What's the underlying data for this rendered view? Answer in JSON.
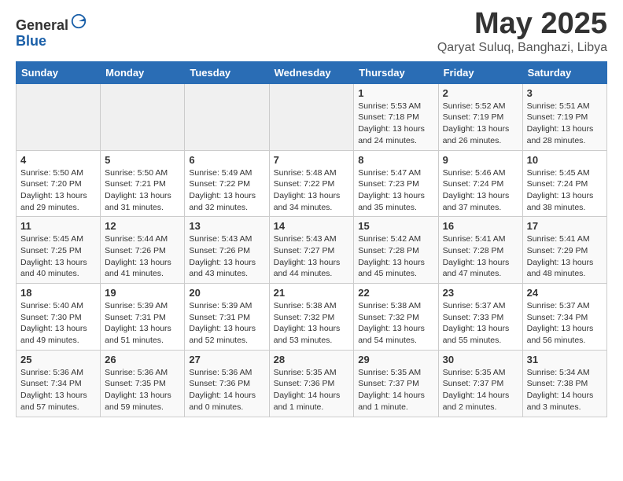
{
  "header": {
    "logo_general": "General",
    "logo_blue": "Blue",
    "month_title": "May 2025",
    "location": "Qaryat Suluq, Banghazi, Libya"
  },
  "weekdays": [
    "Sunday",
    "Monday",
    "Tuesday",
    "Wednesday",
    "Thursday",
    "Friday",
    "Saturday"
  ],
  "weeks": [
    [
      {
        "day": "",
        "info": ""
      },
      {
        "day": "",
        "info": ""
      },
      {
        "day": "",
        "info": ""
      },
      {
        "day": "",
        "info": ""
      },
      {
        "day": "1",
        "info": "Sunrise: 5:53 AM\nSunset: 7:18 PM\nDaylight: 13 hours and 24 minutes."
      },
      {
        "day": "2",
        "info": "Sunrise: 5:52 AM\nSunset: 7:19 PM\nDaylight: 13 hours and 26 minutes."
      },
      {
        "day": "3",
        "info": "Sunrise: 5:51 AM\nSunset: 7:19 PM\nDaylight: 13 hours and 28 minutes."
      }
    ],
    [
      {
        "day": "4",
        "info": "Sunrise: 5:50 AM\nSunset: 7:20 PM\nDaylight: 13 hours and 29 minutes."
      },
      {
        "day": "5",
        "info": "Sunrise: 5:50 AM\nSunset: 7:21 PM\nDaylight: 13 hours and 31 minutes."
      },
      {
        "day": "6",
        "info": "Sunrise: 5:49 AM\nSunset: 7:22 PM\nDaylight: 13 hours and 32 minutes."
      },
      {
        "day": "7",
        "info": "Sunrise: 5:48 AM\nSunset: 7:22 PM\nDaylight: 13 hours and 34 minutes."
      },
      {
        "day": "8",
        "info": "Sunrise: 5:47 AM\nSunset: 7:23 PM\nDaylight: 13 hours and 35 minutes."
      },
      {
        "day": "9",
        "info": "Sunrise: 5:46 AM\nSunset: 7:24 PM\nDaylight: 13 hours and 37 minutes."
      },
      {
        "day": "10",
        "info": "Sunrise: 5:45 AM\nSunset: 7:24 PM\nDaylight: 13 hours and 38 minutes."
      }
    ],
    [
      {
        "day": "11",
        "info": "Sunrise: 5:45 AM\nSunset: 7:25 PM\nDaylight: 13 hours and 40 minutes."
      },
      {
        "day": "12",
        "info": "Sunrise: 5:44 AM\nSunset: 7:26 PM\nDaylight: 13 hours and 41 minutes."
      },
      {
        "day": "13",
        "info": "Sunrise: 5:43 AM\nSunset: 7:26 PM\nDaylight: 13 hours and 43 minutes."
      },
      {
        "day": "14",
        "info": "Sunrise: 5:43 AM\nSunset: 7:27 PM\nDaylight: 13 hours and 44 minutes."
      },
      {
        "day": "15",
        "info": "Sunrise: 5:42 AM\nSunset: 7:28 PM\nDaylight: 13 hours and 45 minutes."
      },
      {
        "day": "16",
        "info": "Sunrise: 5:41 AM\nSunset: 7:28 PM\nDaylight: 13 hours and 47 minutes."
      },
      {
        "day": "17",
        "info": "Sunrise: 5:41 AM\nSunset: 7:29 PM\nDaylight: 13 hours and 48 minutes."
      }
    ],
    [
      {
        "day": "18",
        "info": "Sunrise: 5:40 AM\nSunset: 7:30 PM\nDaylight: 13 hours and 49 minutes."
      },
      {
        "day": "19",
        "info": "Sunrise: 5:39 AM\nSunset: 7:31 PM\nDaylight: 13 hours and 51 minutes."
      },
      {
        "day": "20",
        "info": "Sunrise: 5:39 AM\nSunset: 7:31 PM\nDaylight: 13 hours and 52 minutes."
      },
      {
        "day": "21",
        "info": "Sunrise: 5:38 AM\nSunset: 7:32 PM\nDaylight: 13 hours and 53 minutes."
      },
      {
        "day": "22",
        "info": "Sunrise: 5:38 AM\nSunset: 7:32 PM\nDaylight: 13 hours and 54 minutes."
      },
      {
        "day": "23",
        "info": "Sunrise: 5:37 AM\nSunset: 7:33 PM\nDaylight: 13 hours and 55 minutes."
      },
      {
        "day": "24",
        "info": "Sunrise: 5:37 AM\nSunset: 7:34 PM\nDaylight: 13 hours and 56 minutes."
      }
    ],
    [
      {
        "day": "25",
        "info": "Sunrise: 5:36 AM\nSunset: 7:34 PM\nDaylight: 13 hours and 57 minutes."
      },
      {
        "day": "26",
        "info": "Sunrise: 5:36 AM\nSunset: 7:35 PM\nDaylight: 13 hours and 59 minutes."
      },
      {
        "day": "27",
        "info": "Sunrise: 5:36 AM\nSunset: 7:36 PM\nDaylight: 14 hours and 0 minutes."
      },
      {
        "day": "28",
        "info": "Sunrise: 5:35 AM\nSunset: 7:36 PM\nDaylight: 14 hours and 1 minute."
      },
      {
        "day": "29",
        "info": "Sunrise: 5:35 AM\nSunset: 7:37 PM\nDaylight: 14 hours and 1 minute."
      },
      {
        "day": "30",
        "info": "Sunrise: 5:35 AM\nSunset: 7:37 PM\nDaylight: 14 hours and 2 minutes."
      },
      {
        "day": "31",
        "info": "Sunrise: 5:34 AM\nSunset: 7:38 PM\nDaylight: 14 hours and 3 minutes."
      }
    ]
  ]
}
